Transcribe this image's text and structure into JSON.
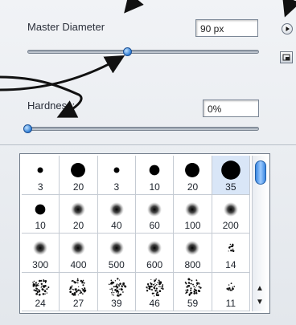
{
  "panel": {
    "master_diameter_label": "Master Diameter",
    "master_diameter_value": "90 px",
    "master_diameter_slider_fraction": 0.43,
    "hardness_label": "Hardness:",
    "hardness_value": "0%",
    "hardness_slider_fraction": 0.0,
    "accent_color": "#2f7ed6"
  },
  "presets": [
    {
      "size": "3",
      "style": "hard"
    },
    {
      "size": "20",
      "style": "hard"
    },
    {
      "size": "3",
      "style": "hard"
    },
    {
      "size": "10",
      "style": "hard"
    },
    {
      "size": "20",
      "style": "hard"
    },
    {
      "size": "35",
      "style": "hard"
    },
    {
      "size": "10",
      "style": "hard"
    },
    {
      "size": "20",
      "style": "soft"
    },
    {
      "size": "40",
      "style": "soft"
    },
    {
      "size": "60",
      "style": "soft"
    },
    {
      "size": "100",
      "style": "soft"
    },
    {
      "size": "200",
      "style": "soft"
    },
    {
      "size": "300",
      "style": "soft"
    },
    {
      "size": "400",
      "style": "soft"
    },
    {
      "size": "500",
      "style": "soft"
    },
    {
      "size": "600",
      "style": "soft"
    },
    {
      "size": "800",
      "style": "soft"
    },
    {
      "size": "14",
      "style": "splatter"
    },
    {
      "size": "24",
      "style": "splatter"
    },
    {
      "size": "27",
      "style": "splatter"
    },
    {
      "size": "39",
      "style": "splatter"
    },
    {
      "size": "46",
      "style": "splatter"
    },
    {
      "size": "59",
      "style": "splatter"
    },
    {
      "size": "11",
      "style": "splatter"
    }
  ]
}
